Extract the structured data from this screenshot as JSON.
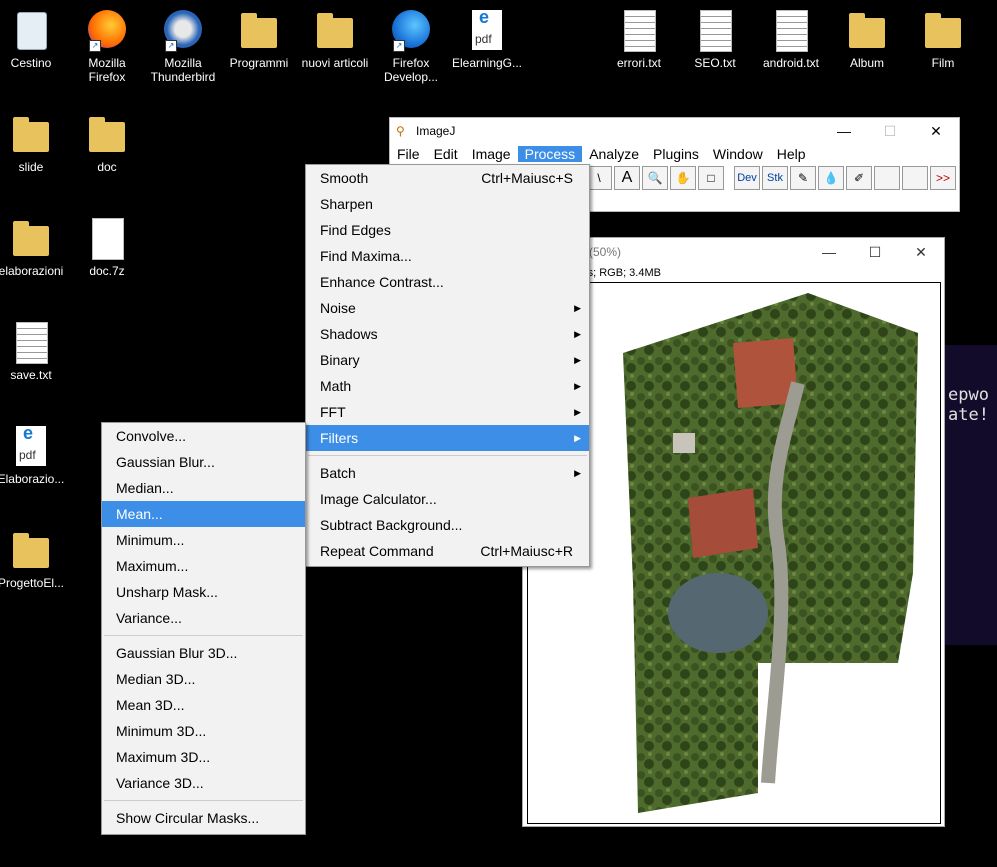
{
  "desktop_icons": [
    {
      "label": "Cestino",
      "icon": "recycle-bin-icon"
    },
    {
      "label": "Mozilla\nFirefox",
      "icon": "firefox-icon"
    },
    {
      "label": "Mozilla\nThunderbird",
      "icon": "thunderbird-icon"
    },
    {
      "label": "Programmi",
      "icon": "folder-icon"
    },
    {
      "label": "nuovi articoli",
      "icon": "folder-icon"
    },
    {
      "label": "Firefox\nDevelop...",
      "icon": "firefox-developer-icon"
    },
    {
      "label": "ElearningG...",
      "icon": "pdf-icon"
    },
    {
      "label": "errori.txt",
      "icon": "text-file-icon"
    },
    {
      "label": "SEO.txt",
      "icon": "text-file-icon"
    },
    {
      "label": "android.txt",
      "icon": "text-file-icon"
    },
    {
      "label": "Album",
      "icon": "folder-icon"
    },
    {
      "label": "Film",
      "icon": "folder-icon"
    },
    {
      "label": "slide",
      "icon": "folder-icon"
    },
    {
      "label": "doc",
      "icon": "folder-icon"
    },
    {
      "label": "elaborazioni",
      "icon": "folder-icon"
    },
    {
      "label": "doc.7z",
      "icon": "file-icon"
    },
    {
      "label": "save.txt",
      "icon": "text-file-icon"
    },
    {
      "label": "Elaborazio...",
      "icon": "pdf-icon"
    },
    {
      "label": "ProgettoEl...",
      "icon": "folder-icon"
    }
  ],
  "imagej": {
    "title": "ImageJ",
    "window_controls": [
      "—",
      "☐",
      "✕"
    ],
    "menu": [
      "File",
      "Edit",
      "Image",
      "Process",
      "Analyze",
      "Plugins",
      "Window",
      "Help"
    ],
    "active_menu": "Process",
    "toolbar": [
      "\\",
      "A",
      "🔍",
      "✋",
      "□",
      "Dev",
      "Stk",
      "✎",
      "💧",
      "✐",
      "",
      "",
      ">>"
    ]
  },
  "image_window": {
    "title": "...g (50%)",
    "info": "pixels; RGB; 3.4MB",
    "window_controls": [
      "—",
      "☐",
      "✕"
    ]
  },
  "game_text": "epwo\nate!",
  "process_menu": [
    {
      "label": "Smooth",
      "shortcut": "Ctrl+Maiusc+S"
    },
    {
      "label": "Sharpen"
    },
    {
      "label": "Find Edges"
    },
    {
      "label": "Find Maxima..."
    },
    {
      "label": "Enhance Contrast..."
    },
    {
      "label": "Noise",
      "submenu": true
    },
    {
      "label": "Shadows",
      "submenu": true
    },
    {
      "label": "Binary",
      "submenu": true
    },
    {
      "label": "Math",
      "submenu": true
    },
    {
      "label": "FFT",
      "submenu": true
    },
    {
      "label": "Filters",
      "submenu": true,
      "highlighted": true
    },
    {
      "separator": true
    },
    {
      "label": "Batch",
      "submenu": true
    },
    {
      "label": "Image Calculator..."
    },
    {
      "label": "Subtract Background..."
    },
    {
      "label": "Repeat Command",
      "shortcut": "Ctrl+Maiusc+R"
    }
  ],
  "filters_menu": [
    {
      "label": "Convolve..."
    },
    {
      "label": "Gaussian Blur..."
    },
    {
      "label": "Median..."
    },
    {
      "label": "Mean...",
      "highlighted": true
    },
    {
      "label": "Minimum..."
    },
    {
      "label": "Maximum..."
    },
    {
      "label": "Unsharp Mask..."
    },
    {
      "label": "Variance..."
    },
    {
      "separator": true
    },
    {
      "label": "Gaussian Blur 3D..."
    },
    {
      "label": "Median 3D..."
    },
    {
      "label": "Mean 3D..."
    },
    {
      "label": "Minimum 3D..."
    },
    {
      "label": "Maximum 3D..."
    },
    {
      "label": "Variance 3D..."
    },
    {
      "separator": true
    },
    {
      "label": "Show Circular Masks..."
    }
  ],
  "colors": {
    "highlight": "#3d8ee6",
    "desktop": "#000000",
    "menu_bg": "#f2f2f2"
  }
}
